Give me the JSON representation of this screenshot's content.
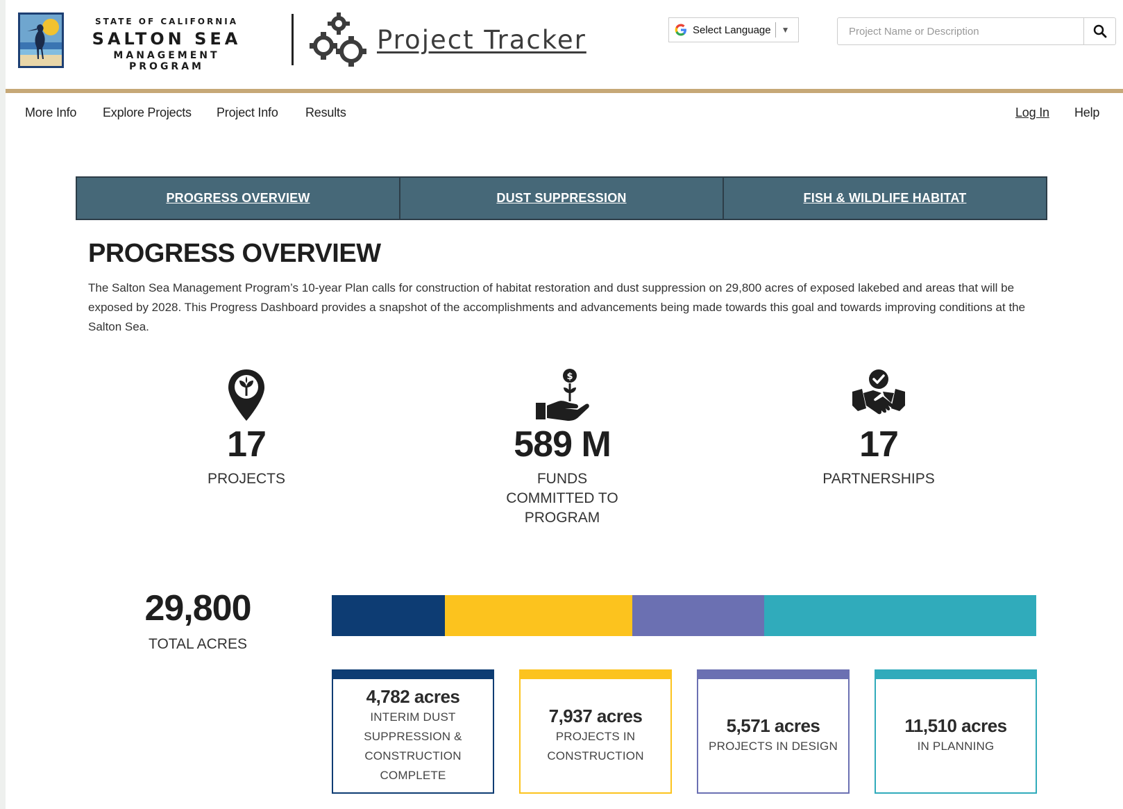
{
  "header": {
    "logo_line1": "STATE OF CALIFORNIA",
    "logo_line2": "SALTON SEA",
    "logo_line3": "MANAGEMENT PROGRAM",
    "tracker_title": "Project Tracker",
    "language_label": "Select Language",
    "search_placeholder": "Project Name or Description"
  },
  "nav": {
    "items": [
      "More Info",
      "Explore Projects",
      "Project Info",
      "Results"
    ],
    "login": "Log In",
    "help": "Help"
  },
  "tabs": [
    "PROGRESS OVERVIEW",
    "DUST SUPPRESSION",
    "FISH & WILDLIFE HABITAT"
  ],
  "main": {
    "title": "PROGRESS OVERVIEW",
    "intro": "The Salton Sea Management Program’s 10-year Plan calls for construction of habitat restoration and dust suppression on 29,800 acres of exposed lakebed and areas that will be exposed by 2028. This Progress Dashboard provides a snapshot of the accomplishments and advancements being made towards this goal and towards improving conditions at the Salton Sea."
  },
  "stats": [
    {
      "value": "17",
      "label_lines": [
        "PROJECTS"
      ],
      "icon": "map-pin-sprout-icon"
    },
    {
      "value": "589 M",
      "label_lines": [
        "FUNDS",
        "COMMITTED TO",
        "PROGRAM"
      ],
      "icon": "hand-money-plant-icon"
    },
    {
      "value": "17",
      "label_lines": [
        "PARTNERSHIPS"
      ],
      "icon": "handshake-check-icon"
    }
  ],
  "acres": {
    "total_value": "29,800",
    "total_label": "TOTAL ACRES",
    "segments": [
      {
        "acres": 4782,
        "value_text": "4,782 acres",
        "label_lines": [
          "INTERIM DUST",
          "SUPPRESSION &",
          "CONSTRUCTION",
          "COMPLETE"
        ],
        "color": "#0d3c73"
      },
      {
        "acres": 7937,
        "value_text": "7,937 acres",
        "label_lines": [
          "PROJECTS IN",
          "CONSTRUCTION"
        ],
        "color": "#fcc31e"
      },
      {
        "acres": 5571,
        "value_text": "5,571 acres",
        "label_lines": [
          "PROJECTS IN DESIGN"
        ],
        "color": "#6b70b2"
      },
      {
        "acres": 11510,
        "value_text": "11,510 acres",
        "label_lines": [
          "IN PLANNING"
        ],
        "color": "#30abbb"
      }
    ]
  },
  "colors": {
    "tab_bg": "#466878",
    "gold_divider": "#c6a877",
    "text_dark": "#1e1e1e"
  }
}
